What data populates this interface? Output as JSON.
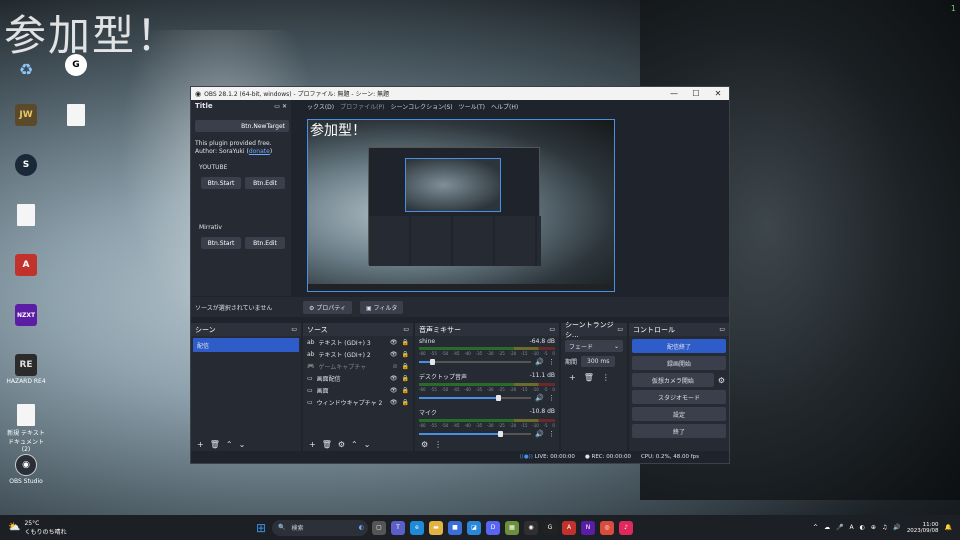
{
  "desktop": {
    "overlay_title": "参加型！",
    "corner_number": "1",
    "icons": [
      {
        "name": "recycle-bin",
        "label": "",
        "glyph": "♻"
      },
      {
        "name": "logitech-ghub",
        "label": "",
        "glyph": "G"
      },
      {
        "name": "jurassic-world",
        "label": "",
        "glyph": "JW"
      },
      {
        "name": "blank-file",
        "label": "",
        "glyph": ""
      },
      {
        "name": "steam",
        "label": "",
        "glyph": "S"
      },
      {
        "name": "blank-file-2",
        "label": "",
        "glyph": ""
      },
      {
        "name": "apex-legends",
        "label": "",
        "glyph": "A"
      },
      {
        "name": "nzxt",
        "label": "",
        "glyph": "NZXT"
      },
      {
        "name": "game-shortcut",
        "label": "HAZARD RE4",
        "glyph": "RE"
      },
      {
        "name": "new-text-doc",
        "label": "新規 テキスト ドキュメント (2)",
        "glyph": ""
      },
      {
        "name": "obs-studio",
        "label": "OBS Studio",
        "glyph": "◉"
      }
    ]
  },
  "obs": {
    "window_title": "OBS 28.1.2 (64-bit, windows) - プロファイル: 無題 - シーン: 無題",
    "window_controls": [
      "—",
      "☐",
      "✕"
    ],
    "menus": [
      "ックス(D)",
      "プロファイル(P)",
      "シーンコレクション(S)",
      "ツール(T)",
      "ヘルプ(H)"
    ],
    "dock": {
      "title": "Title",
      "new_target_label": "Btn.NewTarget",
      "plugin_note": "This plugin provided free.",
      "author_prefix": "Author: SoraYuki (",
      "donate_link": "donate",
      "author_suffix": ")",
      "groups": [
        {
          "name": "YOUTUBE",
          "start": "Btn.Start",
          "edit": "Btn.Edit"
        },
        {
          "name": "Mirrativ",
          "start": "Btn.Start",
          "edit": "Btn.Edit"
        }
      ]
    },
    "preview_title": "参加型！",
    "source_bar": {
      "no_source": "ソースが選択されていません",
      "properties": "プロパティ",
      "filters": "フィルタ"
    },
    "scenes": {
      "header": "シーン",
      "items": [
        "配信"
      ]
    },
    "sources": {
      "header": "ソース",
      "items": [
        {
          "label": "テキスト (GDI+) 3",
          "hidden": false
        },
        {
          "label": "テキスト (GDI+) 2",
          "hidden": false
        },
        {
          "label": "ゲームキャプチャ",
          "hidden": true
        },
        {
          "label": "画面配信",
          "hidden": false
        },
        {
          "label": "画面",
          "hidden": false
        },
        {
          "label": "ウィンドウキャプチャ 2",
          "hidden": false
        }
      ]
    },
    "mixer": {
      "header": "音声ミキサー",
      "ticks": [
        "-60",
        "-55",
        "-50",
        "-45",
        "-40",
        "-35",
        "-30",
        "-25",
        "-20",
        "-15",
        "-10",
        "-5",
        "0"
      ],
      "channels": [
        {
          "name": "shine",
          "db": "-64.8 dB",
          "level": 0.12
        },
        {
          "name": "デスクトップ音声",
          "db": "-11.1 dB",
          "level": 0.7
        },
        {
          "name": "マイク",
          "db": "-10.8 dB",
          "level": 0.72
        }
      ]
    },
    "transitions": {
      "header": "シーントランジシ...",
      "selected": "フェード",
      "duration_label": "期間",
      "duration_value": "300 ms"
    },
    "controls": {
      "header": "コントロール",
      "stop_stream": "配信終了",
      "start_recording": "録画開始",
      "start_virtualcam": "仮想カメラ開始",
      "studio_mode": "スタジオモード",
      "settings": "設定",
      "exit": "終了"
    },
    "status": {
      "live": "LIVE: 00:00:00",
      "rec": "REC: 00:00:00",
      "cpu": "CPU: 0.2%, 48.00 fps"
    }
  },
  "taskbar": {
    "weather_temp": "25°C",
    "weather_desc": "くもりのち晴れ",
    "search_placeholder": "検索",
    "apps": [
      {
        "name": "start",
        "glyph": "⊞",
        "color": "#3a8ee6"
      },
      {
        "name": "task-view",
        "glyph": "▢",
        "color": "#555"
      },
      {
        "name": "teams",
        "glyph": "T",
        "color": "#5b5fc7"
      },
      {
        "name": "edge",
        "glyph": "e",
        "color": "#1f8ad6"
      },
      {
        "name": "explorer",
        "glyph": "▬",
        "color": "#e3b341"
      },
      {
        "name": "store",
        "glyph": "■",
        "color": "#3a6fd8"
      },
      {
        "name": "photos",
        "glyph": "◪",
        "color": "#2b88d8"
      },
      {
        "name": "discord",
        "glyph": "D",
        "color": "#5865f2"
      },
      {
        "name": "minecraft",
        "glyph": "▦",
        "color": "#6b8f3a"
      },
      {
        "name": "obs",
        "glyph": "◉",
        "color": "#302e31"
      },
      {
        "name": "ghub",
        "glyph": "G",
        "color": "#222"
      },
      {
        "name": "apex",
        "glyph": "A",
        "color": "#c2322d"
      },
      {
        "name": "nzxt",
        "glyph": "N",
        "color": "#5b1da6"
      },
      {
        "name": "chrome",
        "glyph": "◎",
        "color": "#d94b3a"
      },
      {
        "name": "tiktok",
        "glyph": "♪",
        "color": "#e0285c"
      }
    ],
    "tray_symbols": [
      "^",
      "☁",
      "🎤",
      "A",
      "◐",
      "⊕",
      "♫",
      "🔊"
    ],
    "time": "11:00",
    "date": "2023/09/08"
  }
}
